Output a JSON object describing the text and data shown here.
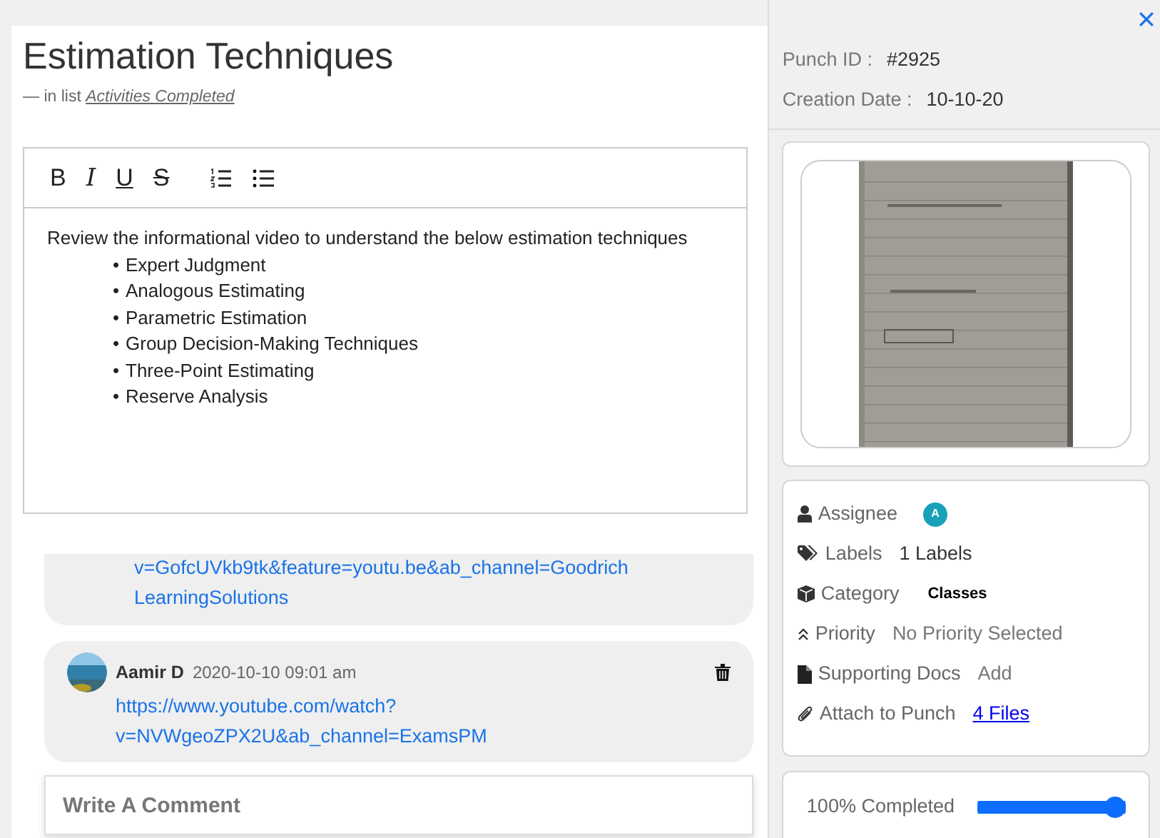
{
  "title": "Estimation Techniques",
  "list": {
    "prefix": "—",
    "label": "in list",
    "name": "Activities Completed"
  },
  "editor": {
    "toolbar": [
      {
        "kind": "bold",
        "label": "B"
      },
      {
        "kind": "italic",
        "label": "I"
      },
      {
        "kind": "underline",
        "label": "U"
      },
      {
        "kind": "strike",
        "label": "S"
      },
      {
        "kind": "ordered-list"
      },
      {
        "kind": "bullet-list"
      }
    ],
    "intro": "Review the informational video to understand the below estimation techniques",
    "bullet": "•",
    "bullets": [
      "Expert Judgment",
      "Analogous Estimating",
      "Parametric Estimation",
      "Group Decision-Making Techniques",
      "Three-Point Estimating",
      "Reserve Analysis"
    ]
  },
  "comments": [
    {
      "partial": true,
      "lines": [
        "v=GofcUVkb9tk&feature=youtu.be&ab_channel=Goodrich",
        "LearningSolutions"
      ]
    },
    {
      "partial": false,
      "author": "Aamir D",
      "time": "2020-10-10 09:01 am",
      "lines": [
        "https://www.youtube.com/watch?",
        "v=NVWgeoZPX2U&ab_channel=ExamsPM"
      ]
    }
  ],
  "comment_box": {
    "placeholder": "Write A Comment"
  },
  "punch": {
    "id_label": "Punch ID :",
    "id": "#2925",
    "date_label": "Creation Date :",
    "date": "10-10-20"
  },
  "details": [
    {
      "kind": "user",
      "label": "Assignee",
      "avatar": "A"
    },
    {
      "kind": "tag",
      "label": "Labels",
      "value": "1 Labels"
    },
    {
      "kind": "cube",
      "label": "Category",
      "value": "Classes",
      "strong": true
    },
    {
      "kind": "priority",
      "label": "Priority",
      "value": "No Priority Selected",
      "muted": true
    },
    {
      "kind": "file",
      "label": "Supporting Docs",
      "value": "Add",
      "muted": true
    },
    {
      "kind": "clip",
      "label": "Attach to Punch",
      "link": "4 Files"
    }
  ],
  "progress": {
    "label": "100% Completed",
    "level": 1
  }
}
